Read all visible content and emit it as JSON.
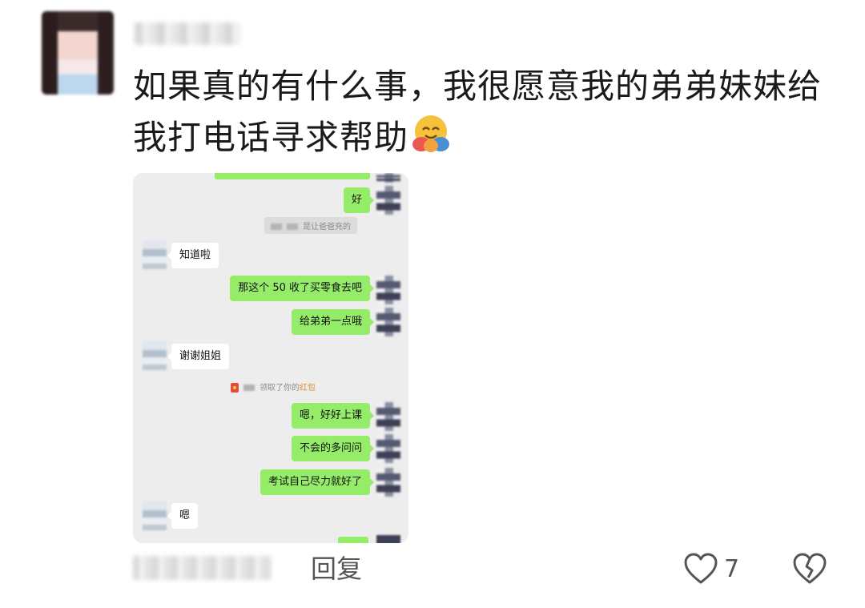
{
  "comment": {
    "text": "如果真的有什么事，我很愿意我的弟弟妹妹给我打电话寻求帮助",
    "emoji": "🤗"
  },
  "screenshot": {
    "messages": [
      {
        "side": "right",
        "text": "好"
      },
      {
        "type": "system",
        "text": "是让爸爸充的"
      },
      {
        "side": "left",
        "text": "知道啦"
      },
      {
        "side": "right",
        "text": "那这个 50 收了买零食去吧"
      },
      {
        "side": "right",
        "text": "给弟弟一点哦"
      },
      {
        "side": "left",
        "text": "谢谢姐姐"
      },
      {
        "type": "system",
        "text_prefix": "领取了你的",
        "text_highlight": "红包"
      },
      {
        "side": "right",
        "text": "嗯，好好上课"
      },
      {
        "side": "right",
        "text": "不会的多问问"
      },
      {
        "side": "right",
        "text": "考试自己尽力就好了"
      },
      {
        "side": "left",
        "text": "嗯"
      }
    ]
  },
  "footer": {
    "reply_label": "回复",
    "like_count": "7",
    "icons": [
      "heart-icon",
      "broken-heart-icon"
    ]
  },
  "colors": {
    "wechat_green": "#95ec69",
    "chat_background": "#ededed"
  }
}
